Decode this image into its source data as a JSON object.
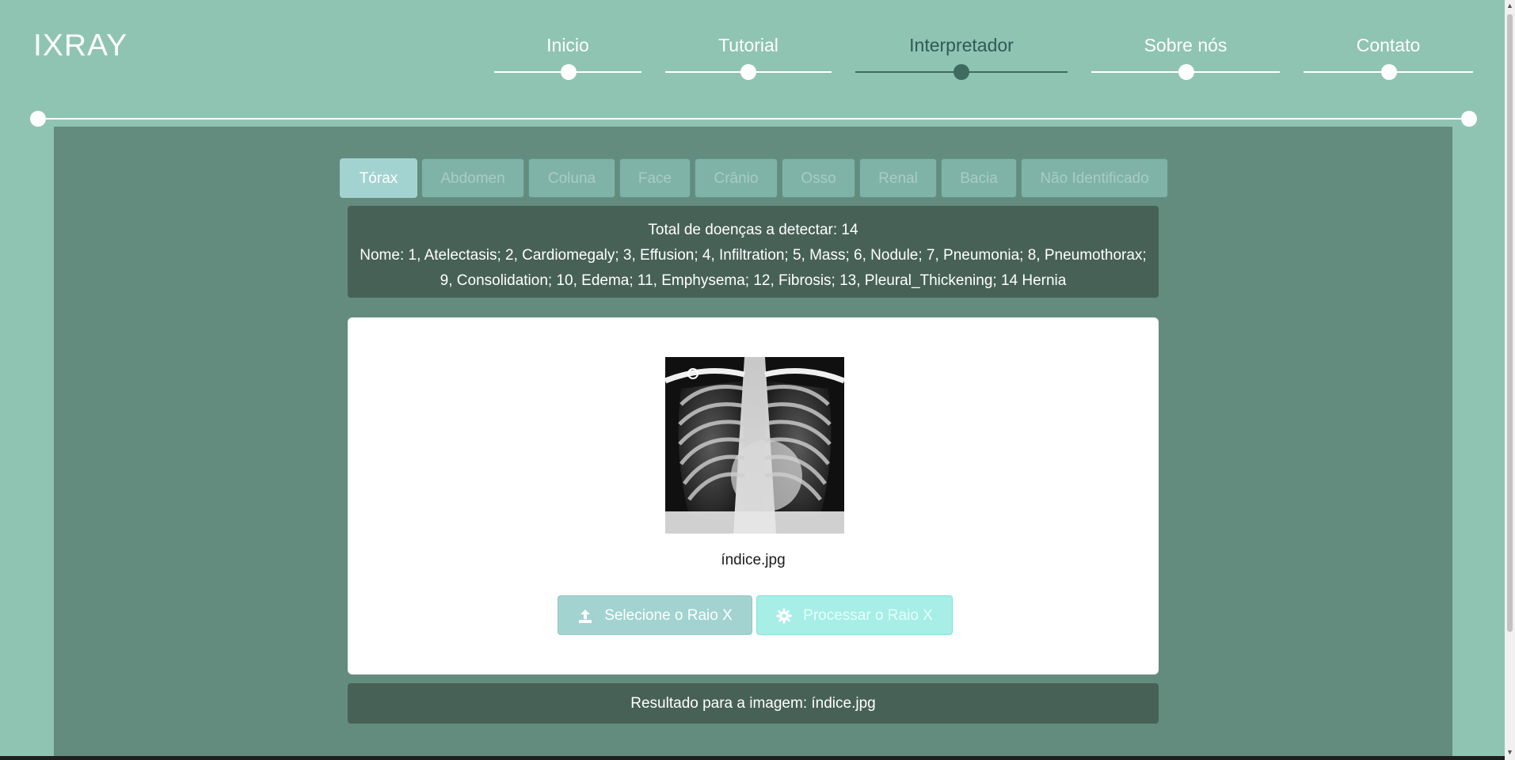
{
  "brand": "IXRAY",
  "nav": {
    "items": [
      {
        "label": "Inicio"
      },
      {
        "label": "Tutorial"
      },
      {
        "label": "Interpretador"
      },
      {
        "label": "Sobre nós"
      },
      {
        "label": "Contato"
      }
    ],
    "active": "Interpretador"
  },
  "tabs": [
    "Tórax",
    "Abdomen",
    "Coluna",
    "Face",
    "Crânio",
    "Osso",
    "Renal",
    "Bacia",
    "Não Identificado"
  ],
  "active_tab": "Tórax",
  "info": {
    "total_line": "Total de doenças a detectar: 14",
    "names_line1": "Nome: 1, Atelectasis; 2, Cardiomegaly; 3, Effusion; 4, Infiltration; 5, Mass; 6, Nodule; 7, Pneumonia; 8, Pneumothorax;",
    "names_line2": "9, Consolidation; 10, Edema; 11, Emphysema; 12, Fibrosis; 13, Pleural_Thickening; 14 Hernia"
  },
  "upload": {
    "filename": "índice.jpg",
    "select_label": "Selecione o Raio X",
    "process_label": "Processar o Raio X"
  },
  "result": {
    "text": "Resultado para a imagem: índice.jpg"
  },
  "colors": {
    "background": "#8fc4b2",
    "panel": "#638c7e",
    "info_box": "#476157",
    "tab_active": "#a2d3d0",
    "process_button": "#a6eee6"
  }
}
